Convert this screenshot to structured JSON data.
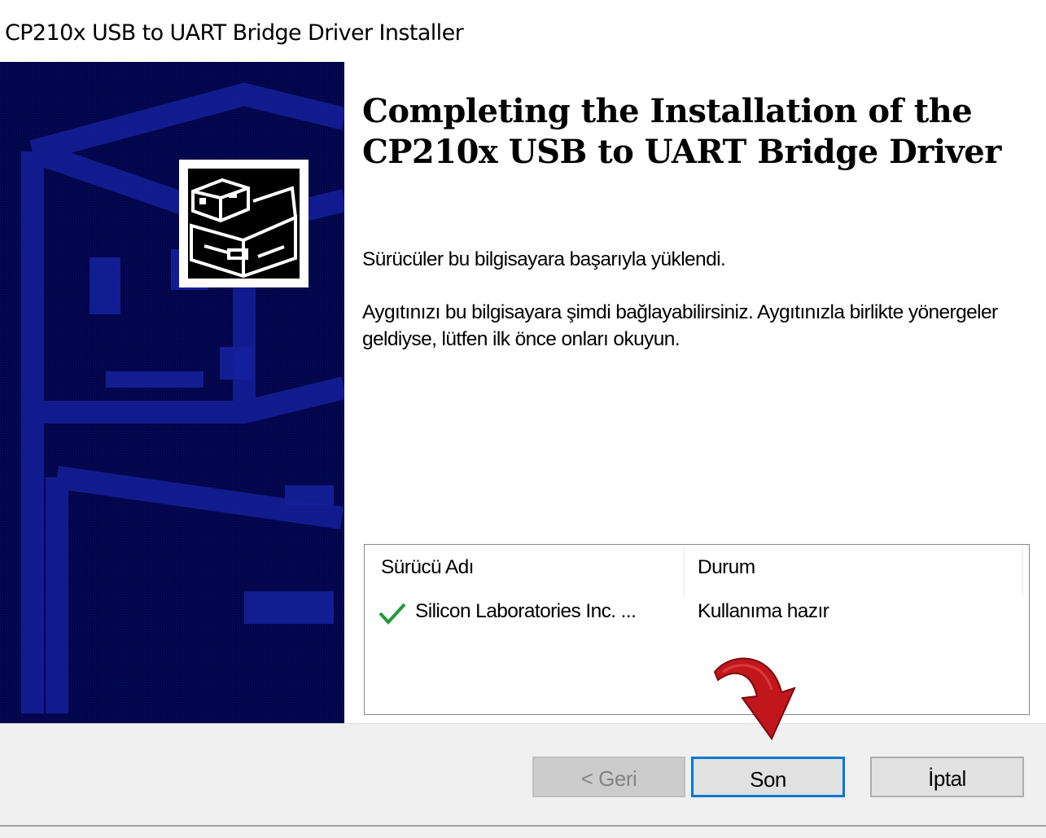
{
  "window": {
    "title": "CP210x USB to UART Bridge Driver Installer"
  },
  "side_panel": {
    "logo_icon": "installer-drive-icon",
    "background_color": "#020548"
  },
  "main": {
    "heading": "Completing the Installation of the CP210x USB to UART Bridge Driver",
    "paragraph1": "Sürücüler bu bilgisayara başarıyla yüklendi.",
    "paragraph2": "Aygıtınızı bu bilgisayara şimdi bağlayabilirsiniz. Aygıtınızla birlikte yönergeler geldiyse, lütfen ilk önce onları okuyun.",
    "driver_list": {
      "columns": [
        "Sürücü Adı",
        "Durum"
      ],
      "rows": [
        {
          "icon": "check-icon",
          "name": "Silicon Laboratories Inc. ...",
          "status": "Kullanıma hazır"
        }
      ]
    }
  },
  "footer": {
    "back_label": "< Geri",
    "finish_label": "Son",
    "cancel_label": "İptal"
  },
  "colors": {
    "accent_focus": "#0078d7",
    "check_green": "#1e9a3a",
    "annotation_arrow": "#c0161c"
  }
}
